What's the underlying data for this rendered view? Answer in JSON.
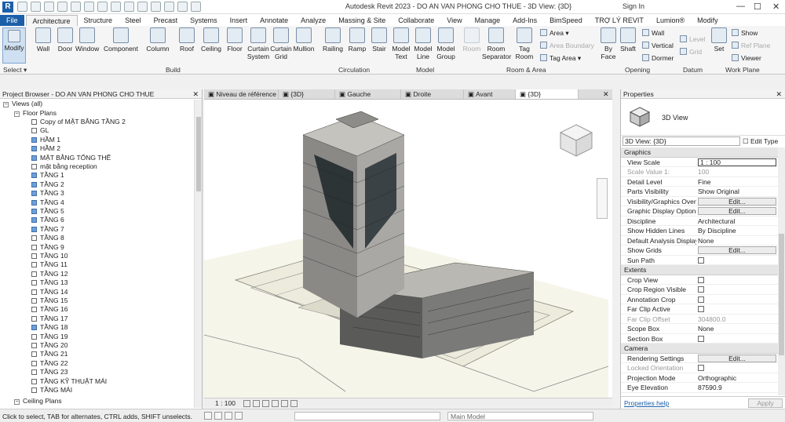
{
  "title_bar": {
    "app_icon": "R",
    "title": "Autodesk Revit 2023 - DO AN VAN PHONG CHO THUE - 3D View: {3D}",
    "sign_in": "Sign In",
    "minimize": "—",
    "maximize": "☐",
    "close": "✕"
  },
  "ribbon_tabs": [
    "File",
    "Architecture",
    "Structure",
    "Steel",
    "Precast",
    "Systems",
    "Insert",
    "Annotate",
    "Analyze",
    "Massing & Site",
    "Collaborate",
    "View",
    "Manage",
    "Add-Ins",
    "BimSpeed",
    "TRỢ LÝ REVIT",
    "Lumion®",
    "Modify"
  ],
  "ribbon": {
    "modify": "Modify",
    "select": "Select ▾",
    "build": {
      "wall": "Wall",
      "door": "Door",
      "window": "Window",
      "component": "Component",
      "column": "Column",
      "roof": "Roof",
      "ceiling": "Ceiling",
      "floor": "Floor",
      "curtain_system": "Curtain System",
      "curtain_grid": "Curtain Grid",
      "mullion": "Mullion"
    },
    "circulation": {
      "railing": "Railing",
      "ramp": "Ramp",
      "stair": "Stair"
    },
    "model": {
      "model_text": "Model Text",
      "model_line": "Model Line",
      "model_group": "Model Group"
    },
    "room_area": {
      "room": "Room",
      "room_separator": "Room Separator",
      "tag_room": "Tag Room",
      "area": "Area ▾",
      "area_boundary": "Area Boundary",
      "tag_area": "Tag Area ▾"
    },
    "opening": {
      "by_face": "By Face",
      "shaft": "Shaft",
      "wall": "Wall",
      "vertical": "Vertical",
      "dormer": "Dormer"
    },
    "datum": {
      "level": "Level",
      "grid": "Grid"
    },
    "work_plane": {
      "set": "Set",
      "show": "Show",
      "ref_plane": "Ref Plane",
      "viewer": "Viewer"
    },
    "panels": [
      "Select ▾",
      "Build",
      "Circulation",
      "Model",
      "Room & Area",
      "Opening",
      "Datum",
      "Work Plane"
    ]
  },
  "project_browser": {
    "title": "Project Browser - DO AN VAN PHONG CHO THUE",
    "views_root": "Views (all)",
    "floor_plans": "Floor Plans",
    "ceiling_plans": "Ceiling Plans",
    "items": [
      {
        "label": "Copy of MẶT BẰNG TẦNG 2",
        "on": false
      },
      {
        "label": "GL",
        "on": false
      },
      {
        "label": "HẦM 1",
        "on": true
      },
      {
        "label": "HẦM 2",
        "on": true
      },
      {
        "label": "MẶT BẰNG TỔNG THỂ",
        "on": true
      },
      {
        "label": "mặt bằng reception",
        "on": false
      },
      {
        "label": "TẦNG 1",
        "on": true
      },
      {
        "label": "TẦNG 2",
        "on": true
      },
      {
        "label": "TẦNG 3",
        "on": true
      },
      {
        "label": "TẦNG 4",
        "on": true
      },
      {
        "label": "TẦNG 5",
        "on": true
      },
      {
        "label": "TẦNG 6",
        "on": true
      },
      {
        "label": "TẦNG 7",
        "on": true
      },
      {
        "label": "TẦNG 8",
        "on": false
      },
      {
        "label": "TẦNG 9",
        "on": false
      },
      {
        "label": "TẦNG 10",
        "on": false
      },
      {
        "label": "TẦNG 11",
        "on": false
      },
      {
        "label": "TẦNG 12",
        "on": false
      },
      {
        "label": "TẦNG 13",
        "on": false
      },
      {
        "label": "TẦNG 14",
        "on": false
      },
      {
        "label": "TẦNG 15",
        "on": false
      },
      {
        "label": "TẦNG 16",
        "on": false
      },
      {
        "label": "TẦNG 17",
        "on": false
      },
      {
        "label": "TẦNG 18",
        "on": true
      },
      {
        "label": "TẦNG 19",
        "on": false
      },
      {
        "label": "TẦNG 20",
        "on": false
      },
      {
        "label": "TẦNG 21",
        "on": false
      },
      {
        "label": "TẦNG 22",
        "on": false
      },
      {
        "label": "TẦNG 23",
        "on": false
      },
      {
        "label": "TẦNG KỸ THUẬT MÁI",
        "on": false
      },
      {
        "label": "TẦNG MÁI",
        "on": false
      }
    ]
  },
  "view_tabs": [
    "Niveau de référence",
    "{3D}",
    "Gauche",
    "Droite",
    "Avant",
    "{3D}"
  ],
  "view_control": {
    "scale": "1 : 100"
  },
  "properties": {
    "title": "Properties",
    "type_name": "3D View",
    "instance": "3D View: {3D}",
    "edit_type": "Edit Type",
    "groups": [
      {
        "name": "Graphics",
        "rows": [
          {
            "k": "View Scale",
            "v": "1 : 100",
            "kind": "input"
          },
          {
            "k": "Scale Value    1:",
            "v": "100",
            "kind": "text",
            "dim": true
          },
          {
            "k": "Detail Level",
            "v": "Fine",
            "kind": "text"
          },
          {
            "k": "Parts Visibility",
            "v": "Show Original",
            "kind": "text"
          },
          {
            "k": "Visibility/Graphics Overr...",
            "v": "Edit...",
            "kind": "button"
          },
          {
            "k": "Graphic Display Options",
            "v": "Edit...",
            "kind": "button"
          },
          {
            "k": "Discipline",
            "v": "Architectural",
            "kind": "text"
          },
          {
            "k": "Show Hidden Lines",
            "v": "By Discipline",
            "kind": "text"
          },
          {
            "k": "Default Analysis Display...",
            "v": "None",
            "kind": "text"
          },
          {
            "k": "Show Grids",
            "v": "Edit...",
            "kind": "button"
          },
          {
            "k": "Sun Path",
            "v": "",
            "kind": "check"
          }
        ]
      },
      {
        "name": "Extents",
        "rows": [
          {
            "k": "Crop View",
            "v": "",
            "kind": "check"
          },
          {
            "k": "Crop Region Visible",
            "v": "",
            "kind": "check"
          },
          {
            "k": "Annotation Crop",
            "v": "",
            "kind": "check"
          },
          {
            "k": "Far Clip Active",
            "v": "",
            "kind": "check"
          },
          {
            "k": "Far Clip Offset",
            "v": "304800.0",
            "kind": "text",
            "dim": true
          },
          {
            "k": "Scope Box",
            "v": "None",
            "kind": "text"
          },
          {
            "k": "Section Box",
            "v": "",
            "kind": "check"
          }
        ]
      },
      {
        "name": "Camera",
        "rows": [
          {
            "k": "Rendering Settings",
            "v": "Edit...",
            "kind": "button"
          },
          {
            "k": "Locked Orientation",
            "v": "",
            "kind": "check",
            "dim": true
          },
          {
            "k": "Projection Mode",
            "v": "Orthographic",
            "kind": "text"
          },
          {
            "k": "Eye Elevation",
            "v": "87590.9",
            "kind": "text"
          }
        ]
      }
    ],
    "help": "Properties help",
    "apply": "Apply"
  },
  "status_bar": {
    "message": "Click to select, TAB for alternates, CTRL adds, SHIFT unselects.",
    "model": "Main Model"
  },
  "colors": {
    "accent": "#1b5fa8",
    "ribbon_bg": "#f5f5f5",
    "selected_box": "#6ea0d8"
  }
}
